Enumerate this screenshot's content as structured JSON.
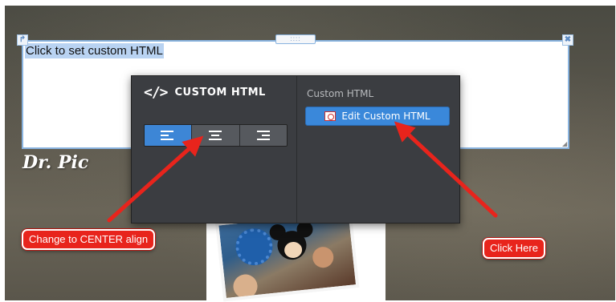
{
  "editor": {
    "placeholder_text": "Click to set custom HTML",
    "drag_handle_dots": "::::",
    "close_glyph": "✖",
    "move_glyph": "↱"
  },
  "page": {
    "title": "Dr. Pic"
  },
  "panel": {
    "code_glyph": "</>",
    "title": "CUSTOM HTML",
    "section_label": "Custom HTML",
    "edit_button_label": "Edit Custom HTML",
    "alignment_options": [
      "left",
      "center",
      "right"
    ],
    "selected_alignment": "left"
  },
  "annotations": {
    "left_callout": "Change to CENTER align",
    "right_callout": "Click Here",
    "color": "#e8241c"
  },
  "colors": {
    "accent": "#3d86d6",
    "panel_bg": "#3b3d41",
    "selection": "#b9d3f2"
  }
}
